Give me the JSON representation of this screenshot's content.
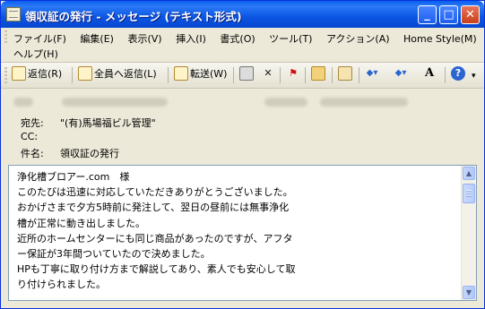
{
  "window": {
    "title": "領収証の発行 - メッセージ (テキスト形式)",
    "controls": {
      "minimize": "_",
      "maximize": "□",
      "close": "✕"
    }
  },
  "menu": {
    "items": [
      "ファイル(F)",
      "編集(E)",
      "表示(V)",
      "挿入(I)",
      "書式(O)",
      "ツール(T)",
      "アクション(A)",
      "Home Style(M)"
    ],
    "second_row": [
      "ヘルプ(H)"
    ]
  },
  "toolbar": {
    "reply": "返信(R)",
    "reply_all": "全員へ返信(L)",
    "forward": "転送(W)",
    "icons": [
      "print-icon",
      "delete-icon",
      "flag-icon",
      "move-to-folder-icon",
      "address-book-icon",
      "previous-item-icon",
      "next-item-icon",
      "font-size-icon",
      "help-icon"
    ]
  },
  "header": {
    "to_label": "宛先:",
    "to_value": "\"(有)馬場福ビル管理\"",
    "cc_label": "CC:",
    "cc_value": "",
    "subject_label": "件名:",
    "subject_value": "領収証の発行"
  },
  "body": {
    "lines": [
      "浄化槽ブロアー.com　様",
      "このたびは迅速に対応していただきありがとうございました。",
      "おかげさまで夕方5時前に発注して、翌日の昼前には無事浄化",
      "槽が正常に動き出しました。",
      "近所のホームセンターにも同じ商品があったのですが、アフタ",
      "ー保証が3年間ついていたので決めました。",
      "HPも丁寧に取り付け方まで解説してあり、素人でも安心して取",
      "り付けられました。"
    ]
  },
  "colors": {
    "titlebar": "#0a5ef0",
    "window_bg": "#ece9d8",
    "body_bg": "#ffffff",
    "scrollbar": "#b8cdfb"
  }
}
